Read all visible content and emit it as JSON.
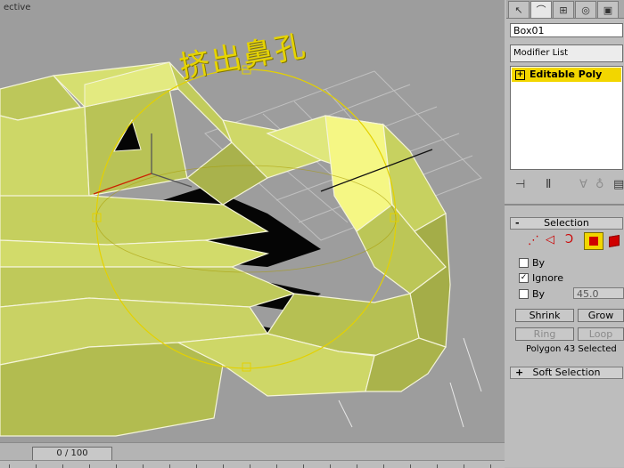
{
  "viewport": {
    "label": "ective",
    "annotation": "挤出鼻孔"
  },
  "timeline": {
    "frame_display": "0 / 100"
  },
  "panel": {
    "tabs": [
      {
        "icon": "select-arrow-icon",
        "glyph": "↖"
      },
      {
        "icon": "modify-icon",
        "glyph": "⌒"
      },
      {
        "icon": "hierarchy-icon",
        "glyph": "⊞"
      },
      {
        "icon": "motion-icon",
        "glyph": "◎"
      },
      {
        "icon": "display-icon",
        "glyph": "▣"
      }
    ],
    "object_name": "Box01",
    "modifier_list_label": "Modifier List",
    "stack_item": "Editable Poly",
    "selection": {
      "title": "Selection",
      "by_vertex_label": "By",
      "ignore_backfacing_label": "Ignore",
      "ignore_checked": "✓",
      "by_angle_label": "By",
      "angle_value": "45.0",
      "shrink_label": "Shrink",
      "grow_label": "Grow",
      "ring_label": "Ring",
      "loop_label": "Loop",
      "status": "Polygon 43 Selected"
    },
    "soft_selection_title": "Soft Selection",
    "accent_color": "#f2d600"
  }
}
